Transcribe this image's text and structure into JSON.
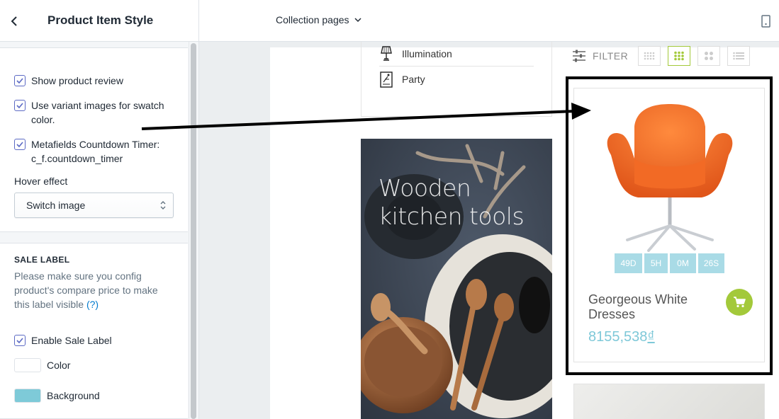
{
  "sidebar": {
    "title": "Product Item Style",
    "options": [
      {
        "label": "Show product review",
        "checked": true
      },
      {
        "label": "Use variant images for swatch color.",
        "checked": true
      },
      {
        "label": "Metafields Countdown Timer: c_f.countdown_timer",
        "checked": true
      }
    ],
    "hover_effect": {
      "label": "Hover effect",
      "value": "Switch image"
    },
    "sale_label": {
      "heading": "SALE LABEL",
      "help_text": "Please make sure you config product's compare price to make this label visible",
      "help_link": "(?)",
      "enable_label": "Enable Sale Label",
      "enable_checked": true,
      "color_label": "Color",
      "color_value": "#ffffff",
      "background_label": "Background",
      "background_value": "#7ecad8"
    }
  },
  "topbar": {
    "page_select": "Collection pages"
  },
  "preview": {
    "categories": [
      {
        "label": "Illumination",
        "icon": "lamp-icon"
      },
      {
        "label": "Party",
        "icon": "party-note-icon"
      }
    ],
    "banner": {
      "line1": "Wooden",
      "line2": "kitchen tools"
    },
    "toolbar": {
      "filter_label": "FILTER",
      "views": [
        "grid-4-icon",
        "grid-3-icon",
        "grid-2-icon",
        "list-icon"
      ],
      "active_view": "grid-3-icon"
    },
    "product": {
      "name": "Georgeous White Dresses",
      "price": "8155,538",
      "currency": "₫",
      "countdown": [
        "49D",
        "5H",
        "0M",
        "26S"
      ],
      "image": "orange-swan-chair"
    }
  },
  "colors": {
    "accent": "#a3c93a",
    "price": "#7ec8d8",
    "countdown_bg": "#a9dbe6",
    "checkbox": "#5c6ac4"
  }
}
